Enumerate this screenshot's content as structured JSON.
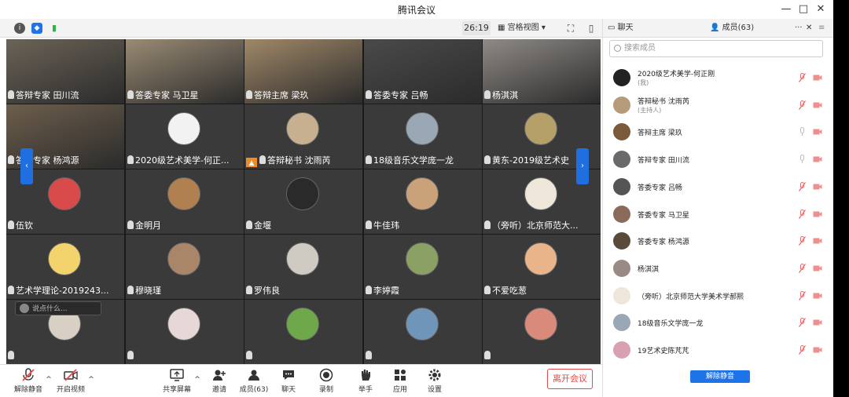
{
  "window": {
    "title": "腾讯会议"
  },
  "toolbar": {
    "timer": "26:19",
    "view_mode": "宫格视图"
  },
  "grid_nav": {
    "left": "‹",
    "right": "›"
  },
  "tiles": [
    {
      "label": "答辩专家 田川流",
      "kind": "video",
      "color": "#6b6357"
    },
    {
      "label": "答委专家 马卫星",
      "kind": "video",
      "color": "#9a8b74"
    },
    {
      "label": "答辩主席 梁玖",
      "kind": "video",
      "color": "#a08868"
    },
    {
      "label": "答委专家 吕畅",
      "kind": "video",
      "color": "#4a4a4a"
    },
    {
      "label": "杨淇淇",
      "kind": "video",
      "color": "#8f8a86"
    },
    {
      "label": "答委专家 杨鸿源",
      "kind": "video",
      "color": "#6d5e4c"
    },
    {
      "label": "2020级艺术美学-何正...",
      "kind": "avatar",
      "color": "#f2f2f2"
    },
    {
      "label": "答辩秘书 沈雨芮",
      "kind": "avatar",
      "color": "#c7b08f",
      "host": true
    },
    {
      "label": "18级音乐文学庞一龙",
      "kind": "avatar",
      "color": "#9aa7b5"
    },
    {
      "label": "黄东-2019级艺术史",
      "kind": "avatar",
      "color": "#b5a06a"
    },
    {
      "label": "伍钦",
      "kind": "avatar",
      "color": "#d94a4a"
    },
    {
      "label": "金明月",
      "kind": "avatar",
      "color": "#b08050"
    },
    {
      "label": "金堰",
      "kind": "avatar",
      "color": "#2a2a2a"
    },
    {
      "label": "牛佳玮",
      "kind": "avatar",
      "color": "#c9a27a"
    },
    {
      "label": "（旁听）北京师范大...",
      "kind": "avatar",
      "color": "#efe6da"
    },
    {
      "label": "艺术学理论-2019243...",
      "kind": "avatar",
      "color": "#f3d36b"
    },
    {
      "label": "穆晓瑾",
      "kind": "avatar",
      "color": "#a88667"
    },
    {
      "label": "罗伟良",
      "kind": "avatar",
      "color": "#cfcac2"
    },
    {
      "label": "李婷霞",
      "kind": "avatar",
      "color": "#8aa064"
    },
    {
      "label": "不爱吃葱",
      "kind": "avatar",
      "color": "#e9b48a"
    },
    {
      "label": "",
      "kind": "avatar",
      "color": "#d8d0c5"
    },
    {
      "label": "",
      "kind": "avatar",
      "color": "#e6d8d6"
    },
    {
      "label": "",
      "kind": "avatar",
      "color": "#6fa84a"
    },
    {
      "label": "",
      "kind": "avatar",
      "color": "#6f95b8"
    },
    {
      "label": "",
      "kind": "avatar",
      "color": "#d98a7a"
    }
  ],
  "chat_input": {
    "placeholder": "说点什么..."
  },
  "bottom": {
    "unmute": "解除静音",
    "start_video": "开启视频",
    "share_screen": "共享屏幕",
    "invite": "邀请",
    "members": "成员(63)",
    "chat": "聊天",
    "record": "录制",
    "raise_hand": "举手",
    "apps": "应用",
    "settings": "设置",
    "leave": "离开会议"
  },
  "panel": {
    "tab_chat": "聊天",
    "tab_members": "成员(63)",
    "search_placeholder": "搜索成员",
    "unmute_all": "解除静音",
    "members": [
      {
        "name": "2020级艺术美学-何正刚",
        "sub": "(我)",
        "color": "#222",
        "mic": "muted"
      },
      {
        "name": "答辩秘书 沈雨芮",
        "sub": "(主持人)",
        "color": "#b59b7a",
        "mic": "muted"
      },
      {
        "name": "答辩主席 梁玖",
        "sub": "",
        "color": "#7a5a3a",
        "mic": "on"
      },
      {
        "name": "答辩专家 田川流",
        "sub": "",
        "color": "#6a6a6a",
        "mic": "on"
      },
      {
        "name": "答委专家 吕畅",
        "sub": "",
        "color": "#555",
        "mic": "muted"
      },
      {
        "name": "答委专家 马卫星",
        "sub": "",
        "color": "#8a6a5a",
        "mic": "muted"
      },
      {
        "name": "答委专家 杨鸿源",
        "sub": "",
        "color": "#5a4a3a",
        "mic": "muted"
      },
      {
        "name": "杨淇淇",
        "sub": "",
        "color": "#9a8a86",
        "mic": "muted"
      },
      {
        "name": "（旁听）北京师范大学美术学郝熙",
        "sub": "",
        "color": "#efe6da",
        "mic": "muted"
      },
      {
        "name": "18级音乐文学庞一龙",
        "sub": "",
        "color": "#9aa7b5",
        "mic": "muted"
      },
      {
        "name": "19艺术史陈芃芃",
        "sub": "",
        "color": "#d8a0b0",
        "mic": "muted"
      }
    ]
  },
  "colors": {
    "accent": "#1f73e8",
    "danger": "#e34a4a",
    "muted": "#e86a6a"
  }
}
